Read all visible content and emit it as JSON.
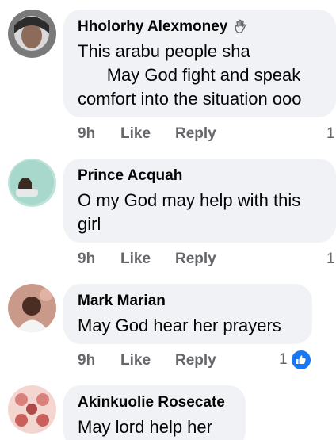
{
  "comments": [
    {
      "author": "Hholorhy Alexmoney",
      "author_badge_icon": "waving-hand-icon",
      "lines": [
        "This arabu people sha",
        "      May God fight and speak",
        "comfort into the situation ooo"
      ],
      "time": "9h",
      "like_label": "Like",
      "reply_label": "Reply",
      "reaction_count": "1"
    },
    {
      "author": "Prince Acquah",
      "lines": [
        "O my God may help with this",
        "girl"
      ],
      "time": "9h",
      "like_label": "Like",
      "reply_label": "Reply",
      "reaction_count": "1"
    },
    {
      "author": "Mark Marian",
      "lines": [
        "May God hear her prayers"
      ],
      "time": "9h",
      "like_label": "Like",
      "reply_label": "Reply",
      "reaction_count": "1",
      "reaction_icon": "thumbs-up-icon"
    },
    {
      "author": "Akinkuolie Rosecate",
      "lines": [
        "May lord help her"
      ]
    }
  ],
  "colors": {
    "bubble": "#f0f2f5",
    "meta_text": "#65676b",
    "like_blue": "#1877f2"
  }
}
